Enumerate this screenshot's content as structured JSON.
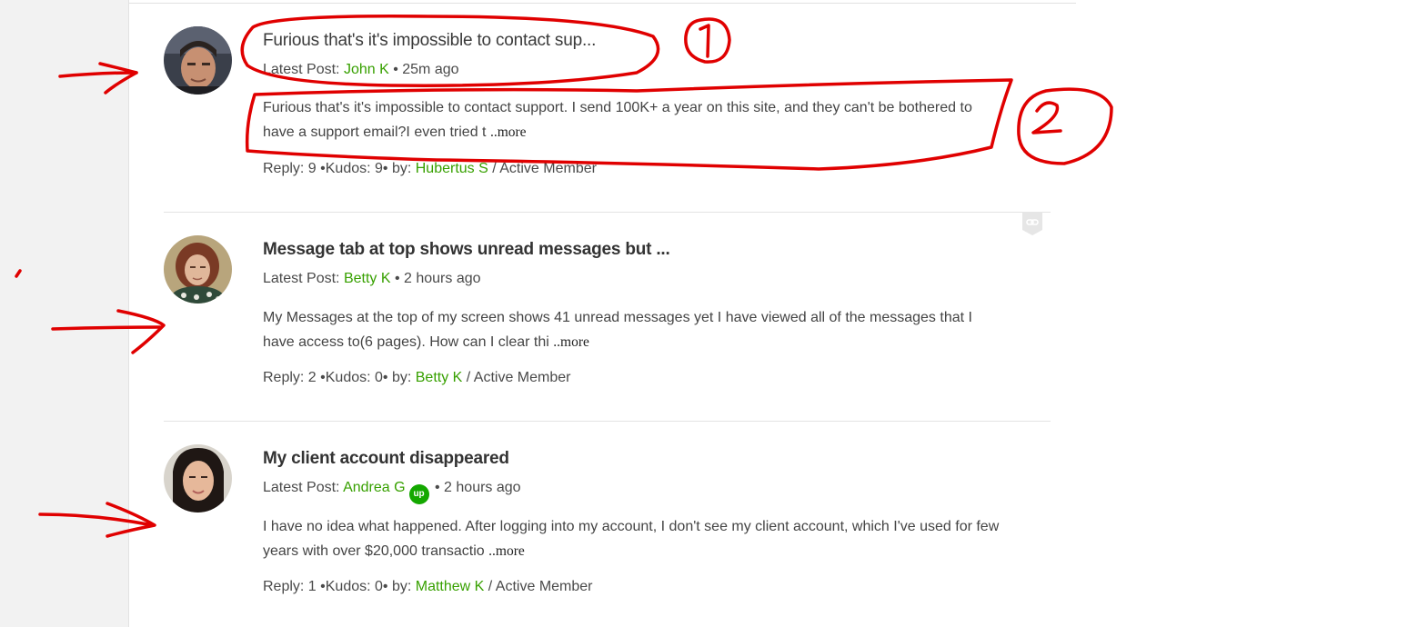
{
  "threads": [
    {
      "title": "Furious that's it's impossible to contact sup...",
      "latest_prefix": "Latest Post: ",
      "latest_author": "John K",
      "latest_sep": " • ",
      "latest_time": "25m ago",
      "snippet": "Furious that's it's impossible to contact support. I send 100K+ a year on this site, and they can't be bothered to have a support email?I even tried t",
      "more": "..more",
      "reply_label": "Reply: 9",
      "kudos_label": " •Kudos: 9•",
      "by_label": " by: ",
      "author": "Hubertus S",
      "rank": " / Active Member"
    },
    {
      "title": "Message tab at top shows unread messages but ...",
      "latest_prefix": "Latest Post: ",
      "latest_author": "Betty K",
      "latest_sep": " • ",
      "latest_time": "2 hours ago",
      "snippet": "My Messages at the top of my screen shows 41 unread messages yet I have viewed all of the messages that I have access to(6 pages). How can I clear thi",
      "more": "..more",
      "reply_label": "Reply: 2",
      "kudos_label": " •Kudos: 0•",
      "by_label": " by: ",
      "author": "Betty K",
      "rank": " / Active Member"
    },
    {
      "title": "My client account disappeared",
      "latest_prefix": "Latest Post: ",
      "latest_author": "Andrea G",
      "badge_text": "up",
      "latest_sep": " • ",
      "latest_time": "2 hours ago",
      "snippet": "I have no idea what happened. After logging into my account, I don't see my client account, which I've used for few years with over $20,000 transactio",
      "more": "..more",
      "reply_label": "Reply: 1",
      "kudos_label": " •Kudos: 0•",
      "by_label": " by: ",
      "author": "Matthew K",
      "rank": " / Active Member"
    }
  ],
  "annotations": {
    "label_1": "1",
    "label_2": "2"
  },
  "colors": {
    "link_green": "#37a000",
    "badge_green": "#14a800",
    "annotation_red": "#e00000"
  }
}
